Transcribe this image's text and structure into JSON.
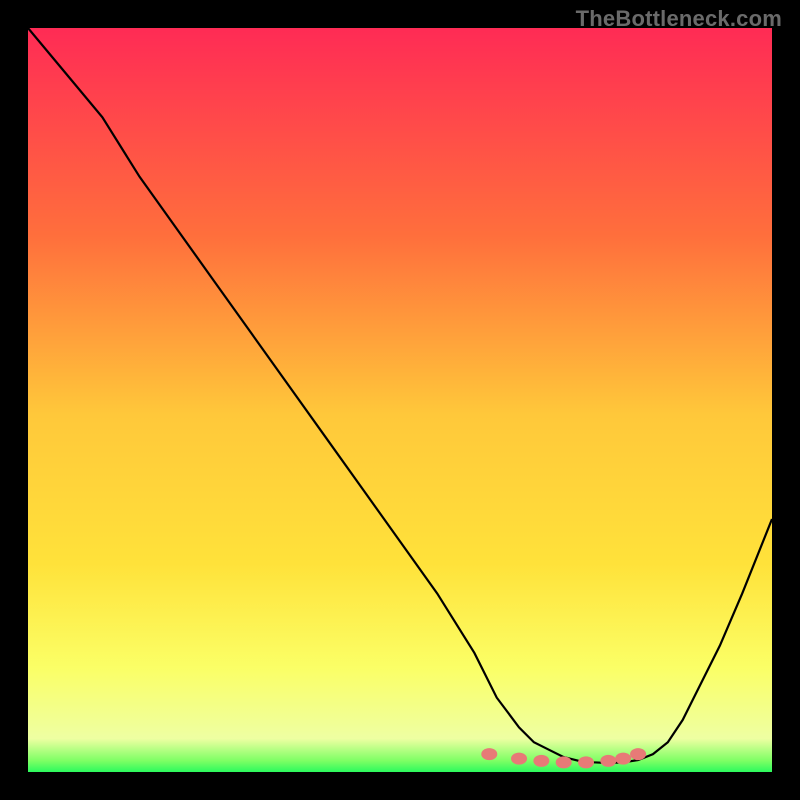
{
  "watermark": "TheBottleneck.com",
  "colors": {
    "frame_bg": "#000000",
    "curve": "#000000",
    "marker": "#e77a77",
    "gradient_top": "#ff2b55",
    "gradient_mid1": "#ff8a34",
    "gradient_mid2": "#ffe23a",
    "gradient_mid3": "#fbff66",
    "gradient_bottom": "#2bfa5e"
  },
  "chart_data": {
    "type": "line",
    "title": "",
    "xlabel": "",
    "ylabel": "",
    "xlim": [
      0,
      100
    ],
    "ylim": [
      0,
      100
    ],
    "x": [
      0,
      5,
      10,
      15,
      20,
      25,
      30,
      35,
      40,
      45,
      50,
      55,
      60,
      63,
      66,
      68,
      70,
      72,
      74,
      76,
      78,
      80,
      82,
      84,
      86,
      88,
      90,
      93,
      96,
      100
    ],
    "values": [
      100,
      94,
      88,
      80,
      73,
      66,
      59,
      52,
      45,
      38,
      31,
      24,
      16,
      10,
      6,
      4,
      3,
      2,
      1.5,
      1.3,
      1.2,
      1.3,
      1.6,
      2.4,
      4,
      7,
      11,
      17,
      24,
      34
    ],
    "markers_x": [
      62,
      66,
      69,
      72,
      75,
      78,
      80,
      82
    ],
    "markers_y": [
      2.4,
      1.8,
      1.5,
      1.3,
      1.3,
      1.5,
      1.8,
      2.4
    ],
    "gradient_axis": "vertical",
    "gradient_meaning": "bottleneck severity (red=high, green=low)"
  }
}
